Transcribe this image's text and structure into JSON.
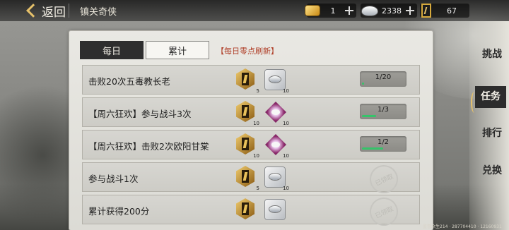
{
  "header": {
    "back_label": "返回",
    "title": "镇关奇侠"
  },
  "resources": [
    {
      "name": "gold-ingot-icon",
      "value": "1"
    },
    {
      "name": "silver-icon",
      "value": "2338"
    },
    {
      "name": "token-icon",
      "value": "67"
    }
  ],
  "tabs": {
    "daily": "每日",
    "cumulative": "累计",
    "refresh_note": "【每日零点刷新】"
  },
  "tasks": [
    {
      "name": "击败20次五毒教长老",
      "reward1_count": "5",
      "reward2_count": "10",
      "progress": "1/20",
      "progress_fraction": 0.05,
      "state": "in-progress"
    },
    {
      "name": "【周六狂欢】参与战斗3次",
      "reward1_count": "10",
      "reward2_count": "10",
      "progress": "1/3",
      "progress_fraction": 0.33,
      "state": "in-progress"
    },
    {
      "name": "【周六狂欢】击败2次欧阳甘棠",
      "reward1_count": "10",
      "reward2_count": "10",
      "progress": "1/2",
      "progress_fraction": 0.5,
      "state": "in-progress"
    },
    {
      "name": "参与战斗1次",
      "reward1_count": "5",
      "reward2_count": "10",
      "stamp": "已领取",
      "state": "claimed"
    },
    {
      "name": "累计获得200分",
      "reward1_count": "",
      "reward2_count": "",
      "stamp": "已领取",
      "state": "claimed"
    }
  ],
  "right_nav": {
    "challenge": "挑战",
    "tasks": "任务",
    "ranking": "排行",
    "exchange": "兑换"
  },
  "footer": "监督众生214 · 287704410 · 12160931"
}
